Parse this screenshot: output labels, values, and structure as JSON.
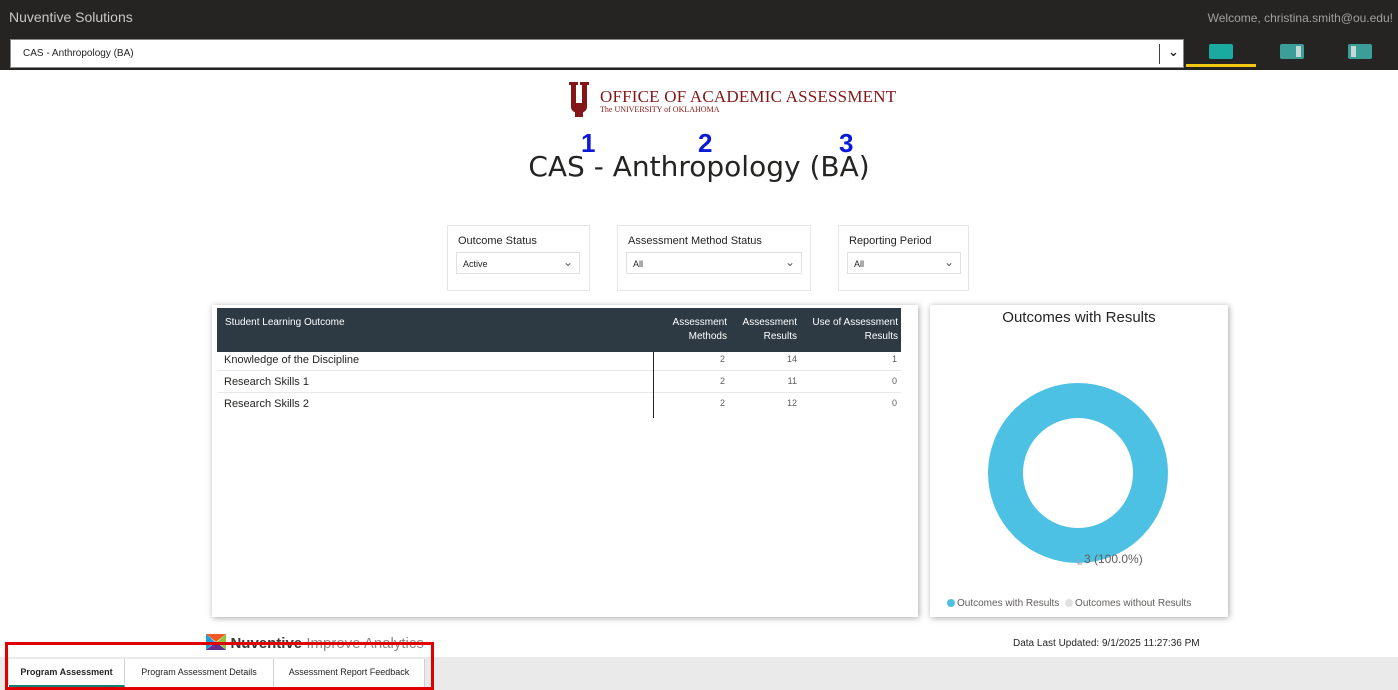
{
  "app": {
    "brand": "Nuventive Solutions",
    "welcome": "Welcome, christina.smith@ou.edu!"
  },
  "program_selector": {
    "value": "CAS - Anthropology (BA)"
  },
  "nav_buttons": [
    {
      "name": "view-button-1",
      "color": "#1aaaa0"
    },
    {
      "name": "view-button-2",
      "color": "#3c9e98"
    },
    {
      "name": "view-button-3",
      "color": "#3c9e98"
    }
  ],
  "logo": {
    "title": "OFFICE OF ACADEMIC ASSESSMENT",
    "subtitle": "The UNIVERSITY of OKLAHOMA",
    "color": "#841617"
  },
  "markers": [
    "1",
    "2",
    "3"
  ],
  "page_title": "CAS - Anthropology (BA)",
  "slicers": [
    {
      "label": "Outcome Status",
      "value": "Active"
    },
    {
      "label": "Assessment Method Status",
      "value": "All"
    },
    {
      "label": "Reporting Period",
      "value": "All"
    }
  ],
  "table": {
    "headers": {
      "outcome": "Student Learning Outcome",
      "methods_1": "Assessment",
      "methods_2": "Methods",
      "results_1": "Assessment",
      "results_2": "Results",
      "use_1": "Use of Assessment",
      "use_2": "Results"
    },
    "rows": [
      {
        "outcome": "Knowledge of the Discipline",
        "methods": "2",
        "results": "14",
        "use": "1"
      },
      {
        "outcome": "Research Skills 1",
        "methods": "2",
        "results": "11",
        "use": "0"
      },
      {
        "outcome": "Research Skills 2",
        "methods": "2",
        "results": "12",
        "use": "0"
      }
    ]
  },
  "chart_data": {
    "type": "pie",
    "title": "Outcomes with Results",
    "categories": [
      "Outcomes with Results",
      "Outcomes without Results"
    ],
    "values": [
      3,
      0
    ],
    "colors": [
      "#4dc1e4",
      "#e0e0e0"
    ],
    "data_label": "3 (100.0%)",
    "legend_position": "bottom"
  },
  "footer": {
    "nuventive_strong": "Nuventive",
    "nuventive_light": " Improve Analytics",
    "data_updated": "Data Last Updated: 9/1/2025 11:27:36 PM"
  },
  "tabs": [
    {
      "label": "Program Assessment",
      "active": true
    },
    {
      "label": "Program Assessment Details",
      "active": false
    },
    {
      "label": "Assessment Report Feedback",
      "active": false
    }
  ]
}
